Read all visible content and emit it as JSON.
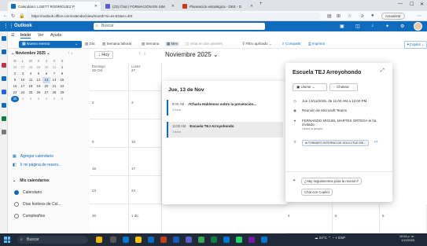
{
  "browser": {
    "tabs": [
      {
        "label": "Calendario: LISETT RODRIGUEZ P",
        "active": true
      },
      {
        "label": "(23) Chat | FORMACIÓN EN SIM",
        "active": false
      },
      {
        "label": "Planeación estratégica - DEE - D",
        "active": false
      }
    ],
    "new_tab": "+",
    "url": "https://outlook.office.com/calendar/view/month?si=es-ES&rn=ES",
    "update_label": "Actualizar"
  },
  "outlook": {
    "app_name": "Outlook",
    "search_placeholder": "Buscar",
    "ribbon_tabs": [
      "Inicio",
      "Ver",
      "Ayuda"
    ],
    "new_event": "Nuevo evento",
    "views": [
      "Día",
      "Semana laboral",
      "Semana",
      "Mes",
      "Vista en dos paneles"
    ],
    "filter": "Filtro aplicado",
    "share": "Compartir",
    "print": "Imprimir",
    "copilot": "Copilot"
  },
  "mini_calendar": {
    "title": "Noviembre 2025",
    "day_heads": [
      "D",
      "L",
      "M",
      "X",
      "J",
      "V",
      "S"
    ],
    "weeks": [
      [
        "26",
        "27",
        "28",
        "29",
        "30",
        "31",
        "1"
      ],
      [
        "2",
        "3",
        "4",
        "5",
        "6",
        "7",
        "8"
      ],
      [
        "9",
        "10",
        "11",
        "12",
        "13",
        "14",
        "15"
      ],
      [
        "16",
        "17",
        "18",
        "19",
        "20",
        "21",
        "22"
      ],
      [
        "23",
        "24",
        "25",
        "26",
        "27",
        "28",
        "29"
      ],
      [
        "30",
        "1",
        "2",
        "3",
        "4",
        "5",
        "6"
      ]
    ]
  },
  "left_pane": {
    "add_calendar": "Agregar calendario",
    "go_booking": "Ir mi página de reserv...",
    "my_calendars": "Mis calendarios",
    "calendars": [
      "Calendario",
      "Días festivos de Col...",
      "Cumpleaños"
    ]
  },
  "calendar": {
    "today_btn": "Hoy",
    "month_title": "Noviembre 2025",
    "col_heads": [
      "Domingo",
      "Lunes"
    ],
    "cells": {
      "r1c1": "26 Oct",
      "r1c2": "27",
      "r2c1": "2",
      "r2c2": "3",
      "r3c1": "9",
      "r3c2": "10",
      "r4c1": "16",
      "r4c2": "17",
      "r5c1": "23",
      "r5c2": "24",
      "r6c1": "30",
      "r6c2": "1 dic",
      "r5c5": "4",
      "r5c6": "5",
      "r5c7": "6"
    }
  },
  "day_popup": {
    "title": "Jue, 13 de Nov",
    "events": [
      {
        "time": "9:00 AM",
        "title": "#Charla Hablemos sobre la prevención...",
        "duration": "1 hora"
      },
      {
        "time": "11:00 AM",
        "title": "Escuela TEJ Arroyohondo",
        "duration": "1 hora"
      }
    ]
  },
  "peek": {
    "title": "Escuela TEJ Arroyohondo",
    "join": "Unirse",
    "chat": "Chatear",
    "datetime": "Jue 13/11/2025, de 11:00 AM a 12:00 PM",
    "teams": "Reunión de Microsoft Teams",
    "organizer": "FERNANDO MIGUEL MARTES ORTEGA le ha invitado.",
    "accepted": "Usted la aceptó.",
    "attendee_chip": "FORMATO INTERNO DE SOLICITUD DE...",
    "attendee_more": "+7",
    "followups": "¿Hay seguimientos para la reunión?",
    "copilot_chat": "Chat con Copilot"
  },
  "taskbar": {
    "search": "Buscar",
    "weather": "24°C",
    "lang": "ESP",
    "time": "10:04 p. m.",
    "date": "1/12/2025"
  }
}
